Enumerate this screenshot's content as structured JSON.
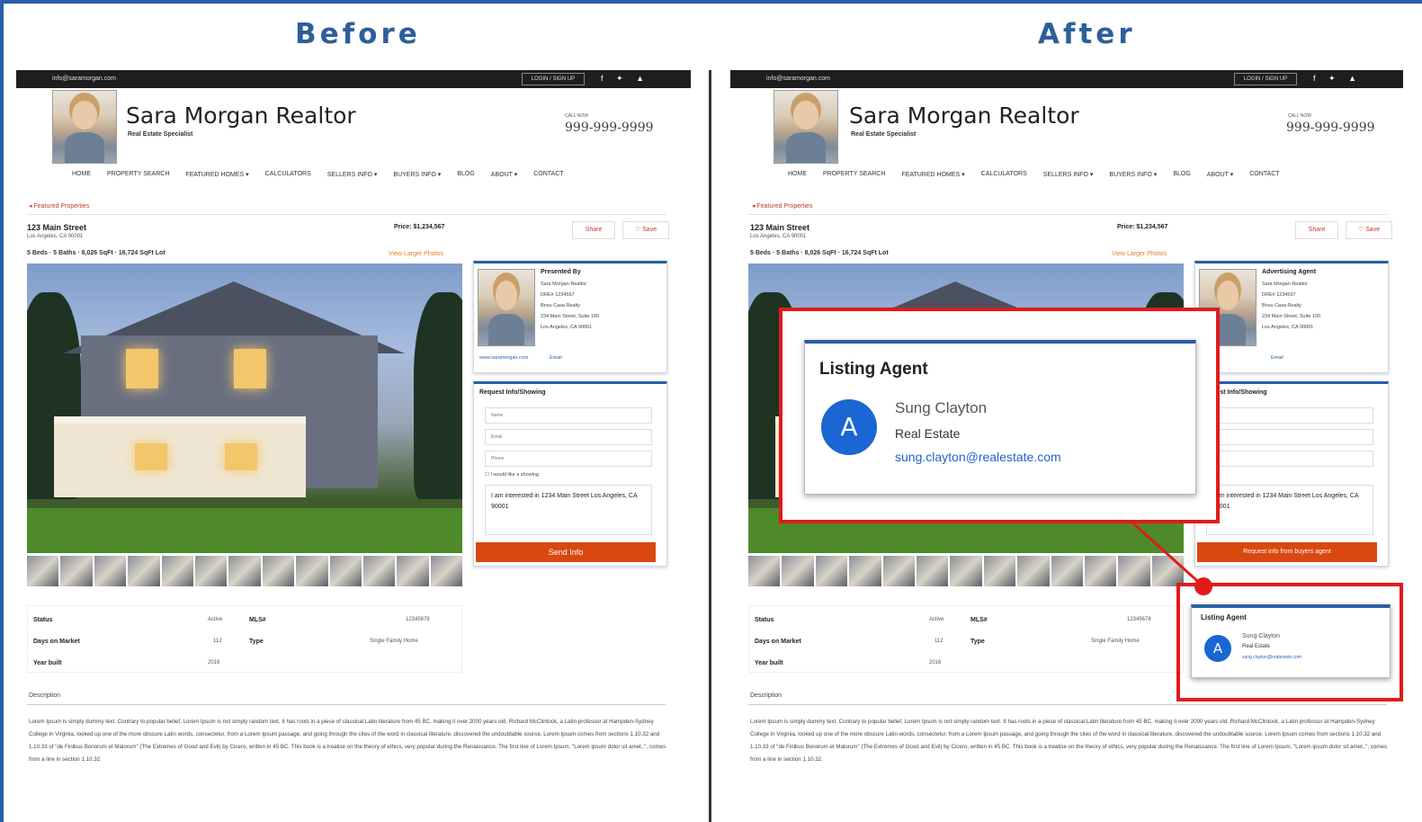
{
  "headings": {
    "before": "Before",
    "after": "After"
  },
  "site": {
    "url": "info@saramorgan.com",
    "login": "LOGIN / SIGN UP",
    "social": "f ✦ ▲",
    "agent_name": "Sara Morgan Realtor",
    "agent_sub": "Real Estate Specialist",
    "call_now": "CALL NOW",
    "phone": "999-999-9999",
    "nav": [
      "HOME",
      "PROPERTY SEARCH",
      "FEATURED HOMES ▾",
      "CALCULATORS",
      "SELLERS INFO ▾",
      "BUYERS INFO ▾",
      "BLOG",
      "ABOUT ▾",
      "CONTACT"
    ],
    "back": "◂ Featured Properties"
  },
  "listing": {
    "address": "123 Main Street",
    "city": "Los Angeles, CA 90001",
    "specs": "5 Beds  ·  5 Baths  ·  8,026 SqFt  ·  16,724 SqFt Lot",
    "price": "Price: $1,234,567",
    "share": "Share",
    "save": "♡ Save",
    "view_larger": "View Larger Photos",
    "facts": {
      "status_label": "Status",
      "status": "Active",
      "mls_label": "MLS#",
      "mls": "12345678",
      "dom_label": "Days on Market",
      "dom": "112",
      "type_label": "Type",
      "type": "Single Family Home",
      "built_label": "Year built",
      "built": "2016"
    },
    "description_label": "Description",
    "description": "Lorem Ipsum is simply dummy text. Contrary to popular belief, Lorem Ipsum is not simply random text. It has roots in a piece of classical Latin literature from 45 BC, making it over 2000 years old. Richard McClintock, a Latin professor at Hampden-Sydney College in Virginia, looked up one of the more obscure Latin words, consectetur, from a Lorem Ipsum passage, and going through the cites of the word in classical literature, discovered the undoubtable source. Lorem Ipsum comes from sections 1.10.32 and 1.10.33 of \"de Finibus Bonorum et Malorum\" (The Extremes of Good and Evil) by Cicero, written in 45 BC. This book is a treatise on the theory of ethics, very popular during the Renaissance. The first line of Lorem Ipsum, \"Lorem ipsum dolor sit amet..\", comes from a line in section 1.10.32."
  },
  "before": {
    "agent_card_title": "Presented By",
    "agent_lines": [
      "Sara Morgan Realtor",
      "DRE# 1234567",
      "Bnsu Casa Realty",
      "234 Main Street, Suite 100",
      "Los Angeles, CA 90001"
    ],
    "agent_links": [
      "www.saramorgan.com",
      "Email"
    ],
    "form_title": "Request Info/Showing",
    "name_ph": "Name",
    "email_ph": "Email",
    "phone_ph": "Phone",
    "checkbox": "I would like a showing",
    "message": "I am interested in 1234 Main Street Los Angeles, CA 90001",
    "submit": "Send Info"
  },
  "after": {
    "agent_card_title": "Advertising Agent",
    "form_title": "Request Info/Showing",
    "message": "I am interested in 1234 Main Street Los Angeles, CA 90001",
    "submit": "Request info from buyers agent",
    "popup": {
      "title": "Listing Agent",
      "initial": "A",
      "name": "Sung Clayton",
      "role": "Real Estate",
      "email": "sung.clayton@realestate.com"
    }
  },
  "colors": {
    "accent": "#2b5fa6",
    "highlight": "#e01b1b",
    "cta": "#d9480f",
    "avatar": "#1a66d2"
  }
}
